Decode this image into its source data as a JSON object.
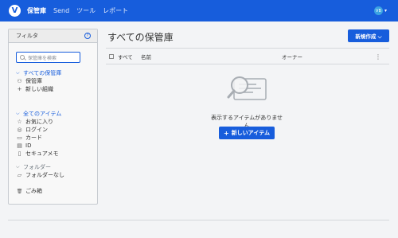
{
  "nav": {
    "logo": "V",
    "links": [
      "保管庫",
      "Send",
      "ツール",
      "レポート"
    ],
    "avatar": "VB",
    "caret": "▾"
  },
  "filters": {
    "title": "フィルタ",
    "help": "?",
    "search_placeholder": "保管庫を検索",
    "vaults": {
      "header": "すべての保管庫",
      "items": [
        {
          "icon": "user-icon",
          "glyph": "⚇",
          "label": "保管庫"
        },
        {
          "icon": "plus-icon",
          "glyph": "+",
          "label": "新しい組織"
        }
      ]
    },
    "items_group": {
      "header": "全てのアイテム",
      "items": [
        {
          "icon": "star-icon",
          "glyph": "☆",
          "label": "お気に入り"
        },
        {
          "icon": "globe-icon",
          "glyph": "◎",
          "label": "ログイン"
        },
        {
          "icon": "card-icon",
          "glyph": "▭",
          "label": "カード"
        },
        {
          "icon": "id-card-icon",
          "glyph": "▤",
          "label": "ID"
        },
        {
          "icon": "note-icon",
          "glyph": "▯",
          "label": "セキュアメモ"
        }
      ]
    },
    "folders": {
      "header": "フォルダー",
      "items": [
        {
          "icon": "folder-icon",
          "glyph": "▱",
          "label": "フォルダーなし"
        }
      ]
    },
    "trash": {
      "icon": "trash-icon",
      "glyph": "🗑",
      "label": "ごみ箱"
    }
  },
  "main": {
    "title": "すべての保管庫",
    "new_button": "新規作成 ⌵",
    "columns": {
      "all": "すべて",
      "name": "名前",
      "owner": "オーナー",
      "menu": "⋮"
    },
    "empty_text": "表示するアイテムがありません",
    "new_item_button": "新しいアイテム",
    "plus": "+"
  },
  "colors": {
    "brand": "#175ddc",
    "background": "#f3f4f6"
  }
}
